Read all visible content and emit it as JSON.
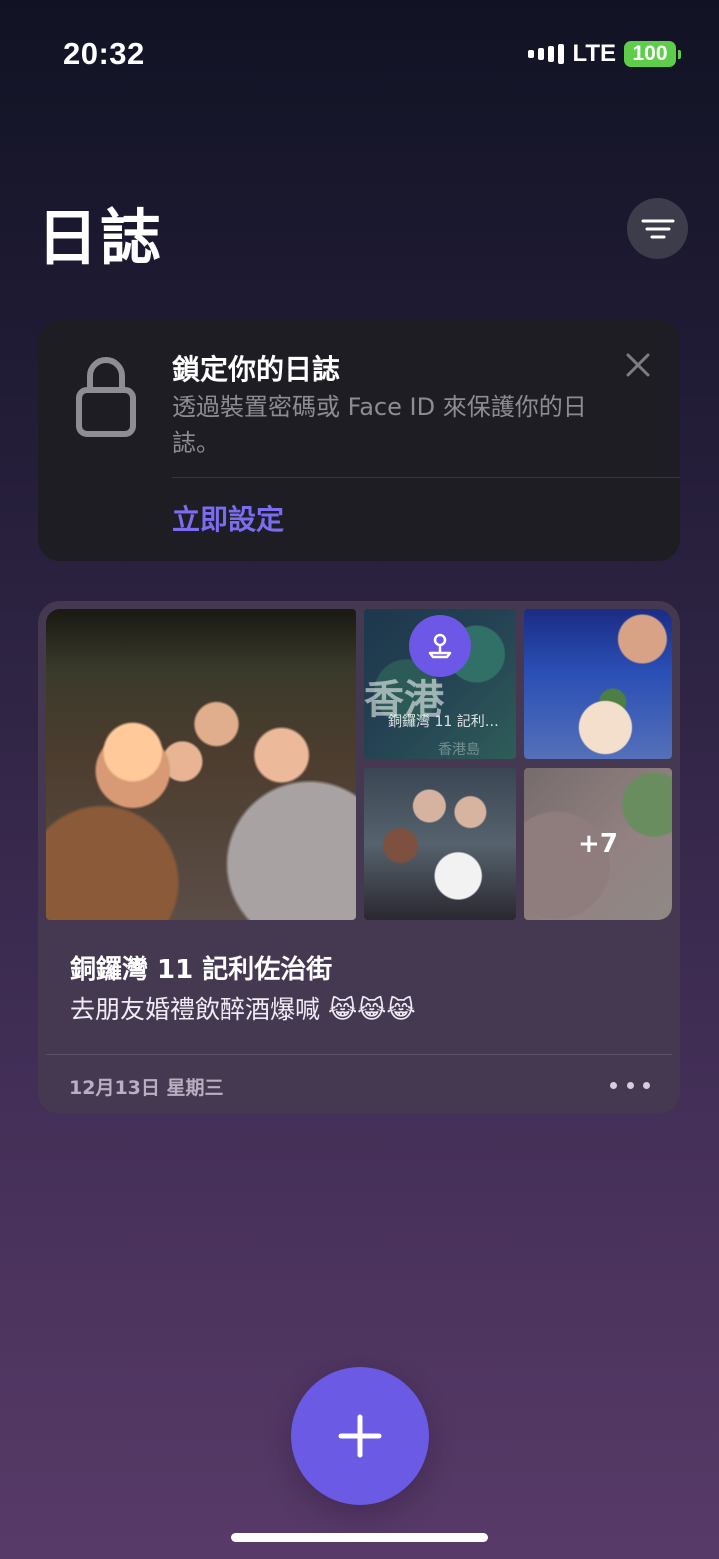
{
  "status_bar": {
    "time": "20:32",
    "network": "LTE",
    "battery": "100"
  },
  "page": {
    "title": "日誌"
  },
  "lock_card": {
    "title": "鎖定你的日誌",
    "description": "透過裝置密碼或 Face ID 來保護你的日誌。",
    "action": "立即設定"
  },
  "entry": {
    "map_big_text": "香港",
    "map_location": "銅鑼灣 11 記利…",
    "map_area": "香港島",
    "more_photos": "+7",
    "title": "銅鑼灣 11 記利佐治街",
    "body": "去朋友婚禮飲醉酒爆喊 😹😹😹",
    "date": "12月13日 星期三"
  },
  "icons": {
    "filter": "filter-icon",
    "lock": "lock-icon",
    "close": "close-icon",
    "pin": "map-pin-icon",
    "more": "more-icon",
    "add": "add-icon"
  },
  "colors": {
    "accent": "#6b5ae4",
    "link": "#7b6cf0",
    "battery": "#5ece4a"
  }
}
